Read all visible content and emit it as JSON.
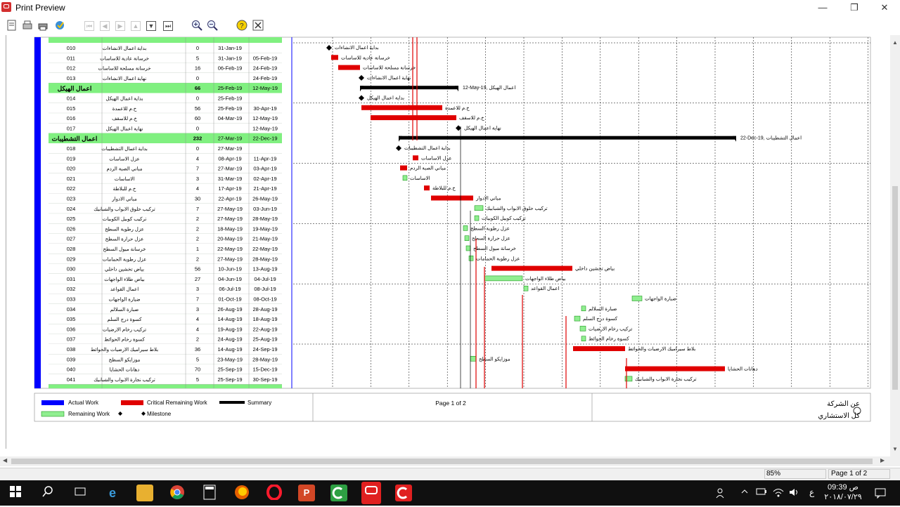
{
  "window": {
    "title": "Print Preview",
    "minimize_glyph": "—",
    "restore_glyph": "❐",
    "close_glyph": "✕"
  },
  "toolbar": {
    "icons": [
      "page-setup-icon",
      "print-icon",
      "printer-icon",
      "options-icon",
      "first-page-icon",
      "prev-page-icon",
      "next-page-icon",
      "up-icon",
      "down-icon",
      "last-page-icon",
      "zoom-in-icon",
      "zoom-out-icon",
      "help-icon",
      "close-preview-icon"
    ]
  },
  "colors": {
    "milestone_green": "#80f080",
    "actual_work": "#0000ff",
    "critical": "#e00000",
    "remaining": "#90ee90",
    "summary": "#000000",
    "left_bar": "#0000ff"
  },
  "tasks": [
    {
      "id": "010",
      "name": "بداية اعمال الانشاءات",
      "dur": "0",
      "start": "31-Jan-19",
      "finish": "",
      "type": "row"
    },
    {
      "id": "011",
      "name": "خرسانة عادية للاساسات",
      "dur": "5",
      "start": "31-Jan-19",
      "finish": "05-Feb-19",
      "type": "row"
    },
    {
      "id": "012",
      "name": "خرسانة مسلحة للاساسات",
      "dur": "16",
      "start": "06-Feb-19",
      "finish": "24-Feb-19",
      "type": "row"
    },
    {
      "id": "013",
      "name": "نهاية اعمال الانشاءات",
      "dur": "0",
      "start": "",
      "finish": "24-Feb-19",
      "type": "row"
    },
    {
      "id": "",
      "name": "اعمال الهيكل",
      "dur": "66",
      "start": "25-Feb-19",
      "finish": "12-May-19",
      "type": "summary"
    },
    {
      "id": "014",
      "name": "بداية اعمال الهيكل",
      "dur": "0",
      "start": "25-Feb-19",
      "finish": "",
      "type": "row"
    },
    {
      "id": "015",
      "name": "خ.م للاعمدة",
      "dur": "56",
      "start": "25-Feb-19",
      "finish": "30-Apr-19",
      "type": "row"
    },
    {
      "id": "016",
      "name": "خ.م للاسقف",
      "dur": "60",
      "start": "04-Mar-19",
      "finish": "12-May-19",
      "type": "row"
    },
    {
      "id": "017",
      "name": "نهاية اعمال الهيكل",
      "dur": "0",
      "start": "",
      "finish": "12-May-19",
      "type": "row"
    },
    {
      "id": "",
      "name": "اعمال التشطيبات",
      "dur": "232",
      "start": "27-Mar-19",
      "finish": "22-Dec-19",
      "type": "summary"
    },
    {
      "id": "018",
      "name": "بداية اعمال التشطيبات",
      "dur": "0",
      "start": "27-Mar-19",
      "finish": "",
      "type": "row"
    },
    {
      "id": "019",
      "name": "عزل الاساسات",
      "dur": "4",
      "start": "08-Apr-19",
      "finish": "11-Apr-19",
      "type": "row"
    },
    {
      "id": "020",
      "name": "مباني الصبة الردم",
      "dur": "7",
      "start": "27-Mar-19",
      "finish": "03-Apr-19",
      "type": "row"
    },
    {
      "id": "021",
      "name": "الاساسات",
      "dur": "3",
      "start": "31-Mar-19",
      "finish": "02-Apr-19",
      "type": "row"
    },
    {
      "id": "022",
      "name": "خ.م للبلاطة",
      "dur": "4",
      "start": "17-Apr-19",
      "finish": "21-Apr-19",
      "type": "row"
    },
    {
      "id": "023",
      "name": "مباني الادوار",
      "dur": "30",
      "start": "22-Apr-19",
      "finish": "26-May-19",
      "type": "row"
    },
    {
      "id": "024",
      "name": "تركيب حلوق الابواب والشبابيك",
      "dur": "7",
      "start": "27-May-19",
      "finish": "03-Jun-19",
      "type": "row"
    },
    {
      "id": "025",
      "name": "تركيب كوبيل الكوبيات",
      "dur": "2",
      "start": "27-May-19",
      "finish": "28-May-19",
      "type": "row"
    },
    {
      "id": "026",
      "name": "عزل رطوبة السطح",
      "dur": "2",
      "start": "18-May-19",
      "finish": "19-May-19",
      "type": "row"
    },
    {
      "id": "027",
      "name": "عزل حرارة السطح",
      "dur": "2",
      "start": "20-May-19",
      "finish": "21-May-19",
      "type": "row"
    },
    {
      "id": "028",
      "name": "خرسانة ميول السطح",
      "dur": "1",
      "start": "22-May-19",
      "finish": "22-May-19",
      "type": "row"
    },
    {
      "id": "029",
      "name": "عزل رطوبة الحمامات",
      "dur": "2",
      "start": "27-May-19",
      "finish": "28-May-19",
      "type": "row"
    },
    {
      "id": "030",
      "name": "بياض تخشين داخلي",
      "dur": "56",
      "start": "10-Jun-19",
      "finish": "13-Aug-19",
      "type": "row"
    },
    {
      "id": "031",
      "name": "بياض طلاء الواجهات",
      "dur": "27",
      "start": "04-Jun-19",
      "finish": "04-Jul-19",
      "type": "row"
    },
    {
      "id": "032",
      "name": "اعمال القواعد",
      "dur": "3",
      "start": "06-Jul-19",
      "finish": "08-Jul-19",
      "type": "row"
    },
    {
      "id": "033",
      "name": "ضبارة الواجهات",
      "dur": "7",
      "start": "01-Oct-19",
      "finish": "08-Oct-19",
      "type": "row"
    },
    {
      "id": "034",
      "name": "ضبارة السلالم",
      "dur": "3",
      "start": "26-Aug-19",
      "finish": "28-Aug-19",
      "type": "row"
    },
    {
      "id": "035",
      "name": "كسوة درج السلم",
      "dur": "4",
      "start": "14-Aug-19",
      "finish": "18-Aug-19",
      "type": "row"
    },
    {
      "id": "036",
      "name": "تركيب رخام الارضيات",
      "dur": "4",
      "start": "19-Aug-19",
      "finish": "22-Aug-19",
      "type": "row"
    },
    {
      "id": "037",
      "name": "كسوة رخام الحوائط",
      "dur": "2",
      "start": "24-Aug-19",
      "finish": "25-Aug-19",
      "type": "row"
    },
    {
      "id": "038",
      "name": "بلاط سيراميك الارضيات والحوائط",
      "dur": "36",
      "start": "14-Aug-19",
      "finish": "24-Sep-19",
      "type": "row"
    },
    {
      "id": "039",
      "name": "موزايكو السطح",
      "dur": "5",
      "start": "23-May-19",
      "finish": "28-May-19",
      "type": "row"
    },
    {
      "id": "040",
      "name": "دهانات الحشايا",
      "dur": "70",
      "start": "25-Sep-19",
      "finish": "15-Dec-19",
      "type": "row"
    },
    {
      "id": "041",
      "name": "تركيب نجارة الابواب والشبابيك",
      "dur": "5",
      "start": "25-Sep-19",
      "finish": "30-Sep-19",
      "type": "row"
    }
  ],
  "gantt_labels": [
    {
      "text": "بداية اعمال الانشاءات"
    },
    {
      "text": "خرسانة عادية للاساسات"
    },
    {
      "text": "خرسانة مسلحة للاساسات"
    },
    {
      "text": "نهاية اعمال الانشاءات"
    },
    {
      "text": "12-May-19, اعمال الهيكل"
    },
    {
      "text": "بداية اعمال الهيكل"
    },
    {
      "text": "خ.م للاعمدة"
    },
    {
      "text": "خ.م للاسقف"
    },
    {
      "text": "نهاية اعمال الهيكل"
    },
    {
      "text": "22-Dec-19, اعمال التشطيبات"
    },
    {
      "text": "بداية اعمال التشطيبات"
    },
    {
      "text": "عزل الاساسات"
    },
    {
      "text": "مباني الصبة الردم"
    },
    {
      "text": "الاساسات"
    },
    {
      "text": "خ.م للبلاطة"
    },
    {
      "text": "مباني الادوار"
    },
    {
      "text": "تركيب حلوق الابواب والشبابيك"
    },
    {
      "text": "تركيب كوبيل الكوبيات"
    },
    {
      "text": "عزل رطوبة السطح"
    },
    {
      "text": "عزل حرارة السطح"
    },
    {
      "text": "خرسانة ميول السطح"
    },
    {
      "text": "عزل رطوبة الحمامات"
    },
    {
      "text": "بياض تخشين داخلي"
    },
    {
      "text": "بياض طلاء الواجهات"
    },
    {
      "text": "اعمال القواعد"
    },
    {
      "text": "ضبارة الواجهات"
    },
    {
      "text": "ضبارة السلالم"
    },
    {
      "text": "كسوة درج السلم"
    },
    {
      "text": "تركيب رخام الارضيات"
    },
    {
      "text": "كسوة رخام الحوائط"
    },
    {
      "text": "بلاط سيراميك الارضيات والحوائط"
    },
    {
      "text": "موزايكو السطح"
    },
    {
      "text": "دهانات الحشايا"
    },
    {
      "text": "تركيب نجارة الابواب والشبابيك"
    }
  ],
  "legend": {
    "actual_work": "Actual Work",
    "critical_remaining": "Critical Remaining Work",
    "summary": "Summary",
    "remaining": "Remaining Work",
    "milestone": "Milestone"
  },
  "footer": {
    "page_text": "Page 1 of 2",
    "company_line1": "عن الشركة",
    "company_line2": "كل الاستشاري"
  },
  "status": {
    "zoom": "85%",
    "page": "Page 1 of 2"
  },
  "clock": {
    "time": "09:39 ص",
    "date": "٢٠١٨/٠٧/٢٩"
  },
  "tray": {
    "lang": "ع"
  }
}
